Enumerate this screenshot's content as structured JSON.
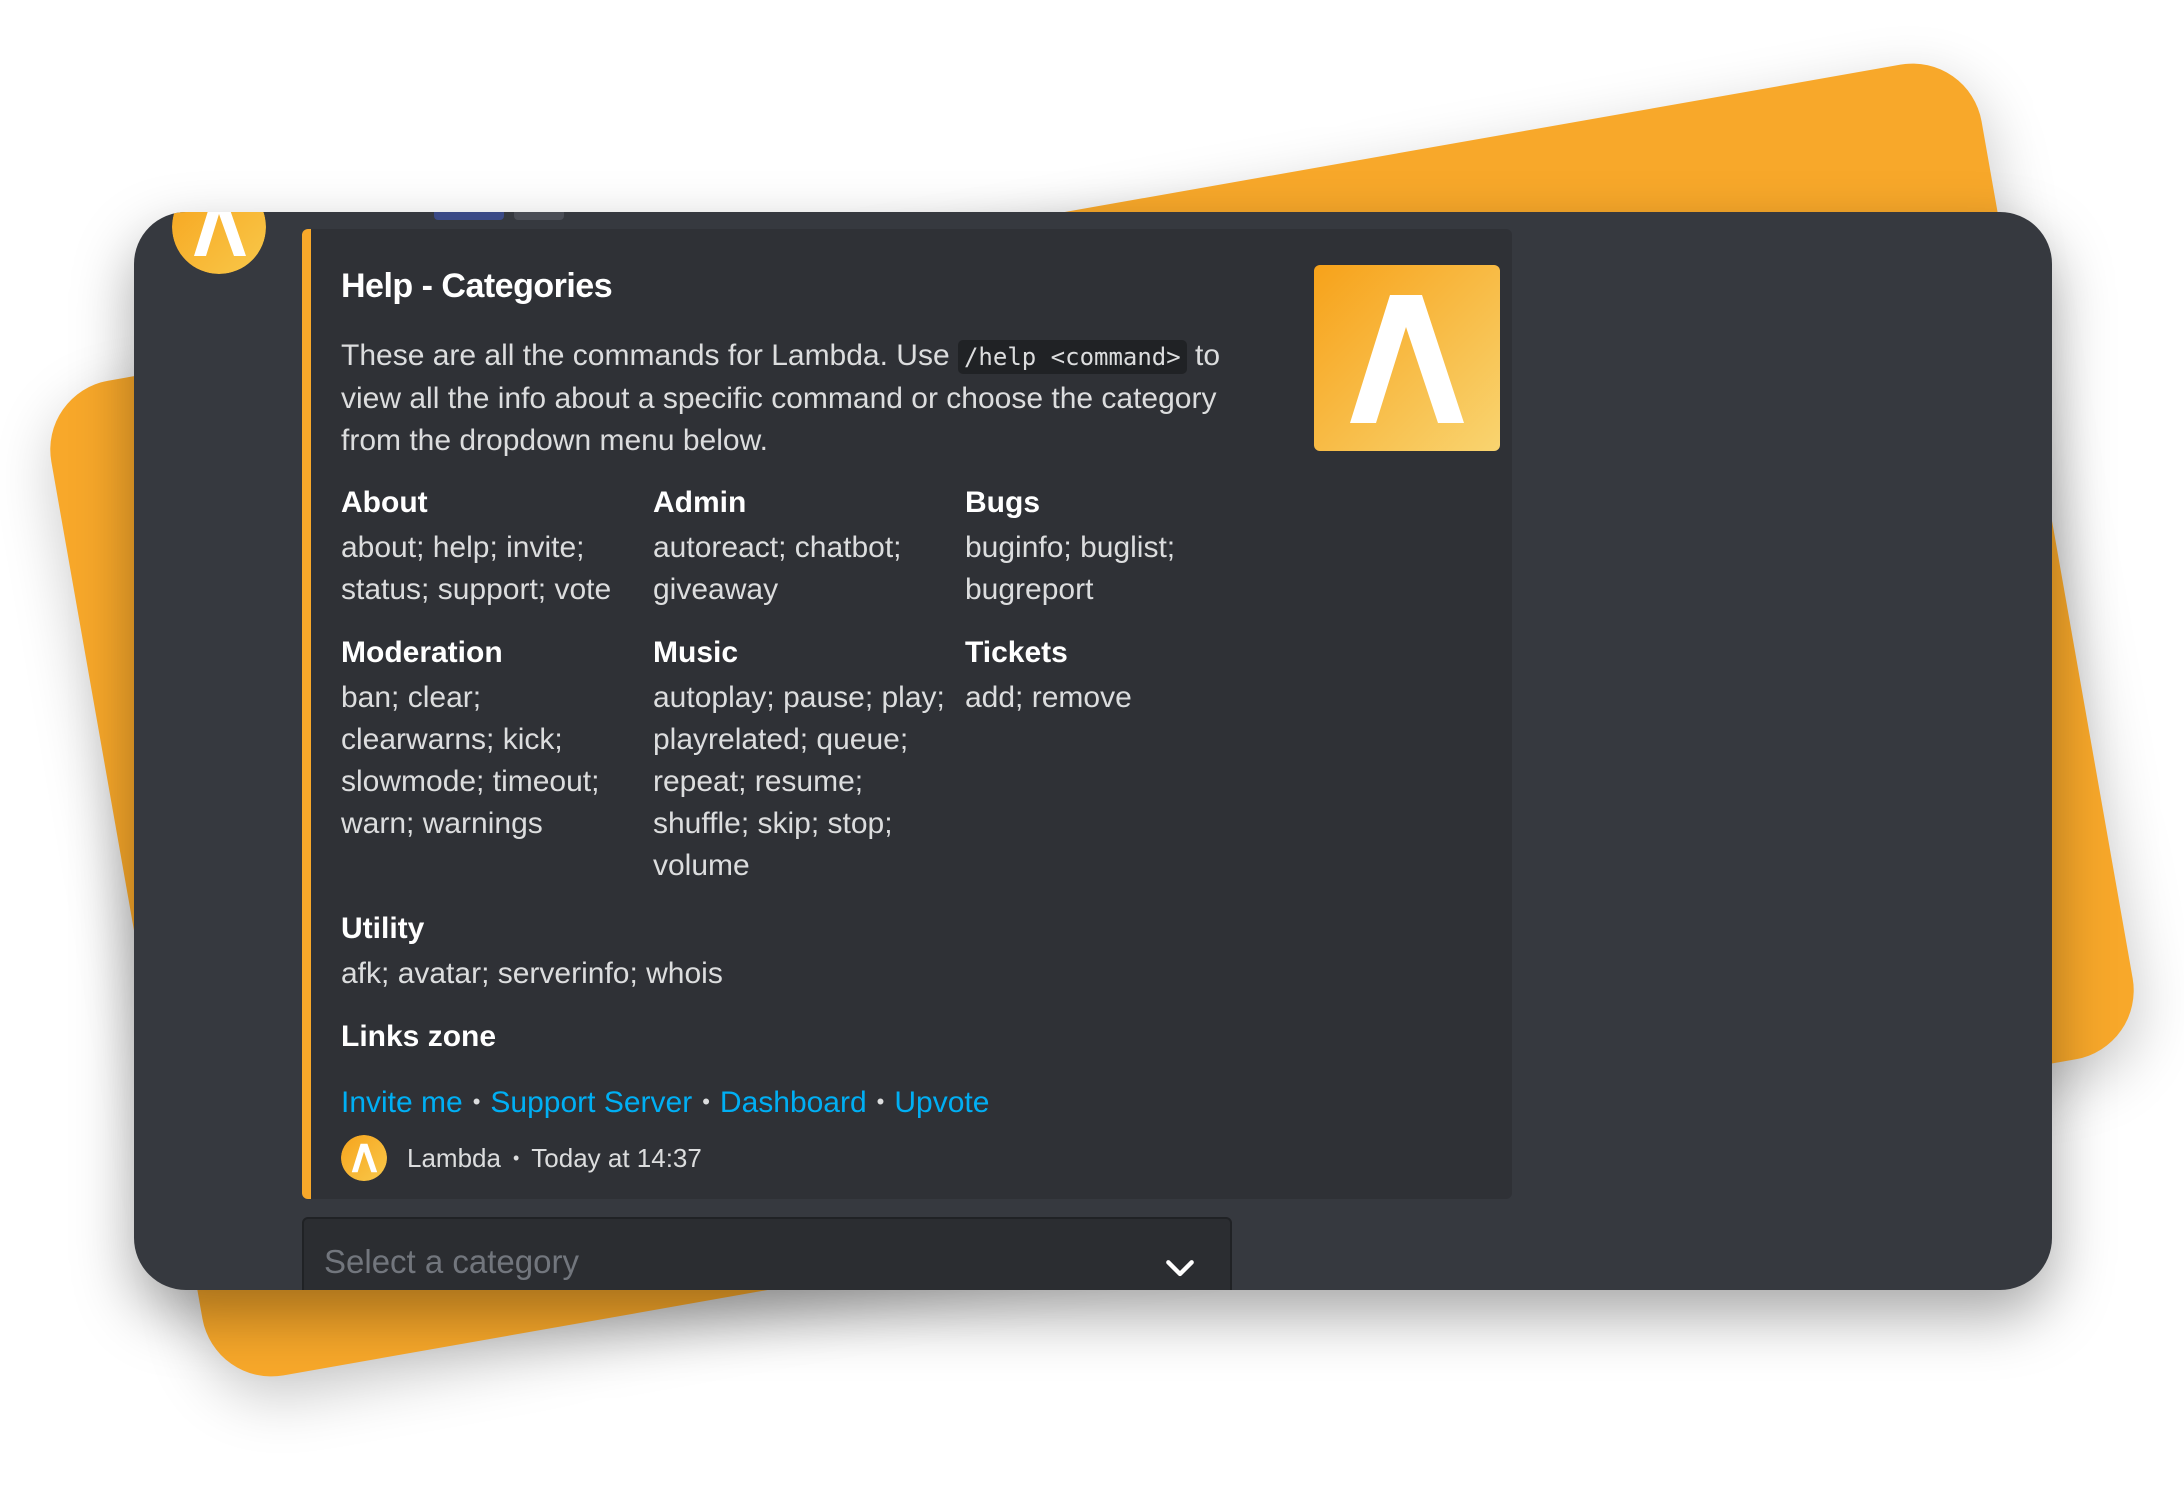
{
  "colors": {
    "accent": "#f8a82a",
    "window_bg": "#36393f",
    "embed_bg": "#2f3136",
    "link": "#00aff4"
  },
  "embed": {
    "title": "Help - Categories",
    "description_part1": "These are all the commands for Lambda. Use ",
    "description_code": "/help <command>",
    "description_part2": " to view all the info about a specific command or choose the category from the dropdown menu below.",
    "thumbnail_icon": "lambda-logo-icon",
    "fields": [
      {
        "name": "About",
        "value": "about; help; invite; status; support; vote"
      },
      {
        "name": "Admin",
        "value": "autoreact; chatbot; giveaway"
      },
      {
        "name": "Bugs",
        "value": "buginfo; buglist; bugreport"
      },
      {
        "name": "Moderation",
        "value": "ban; clear; clearwarns; kick; slowmode; timeout; warn; warnings"
      },
      {
        "name": "Music",
        "value": "autoplay; pause; play; playrelated; queue; repeat; resume; shuffle; skip; stop; volume"
      },
      {
        "name": "Tickets",
        "value": "add; remove"
      },
      {
        "name": "Utility",
        "value": "afk; avatar; serverinfo; whois"
      }
    ],
    "links_title": "Links zone",
    "links": [
      "Invite me",
      "Support Server",
      "Dashboard",
      "Upvote"
    ],
    "footer": {
      "name": "Lambda",
      "timestamp": "Today at 14:37"
    }
  },
  "select": {
    "placeholder": "Select a category",
    "icon": "chevron-down-icon"
  }
}
